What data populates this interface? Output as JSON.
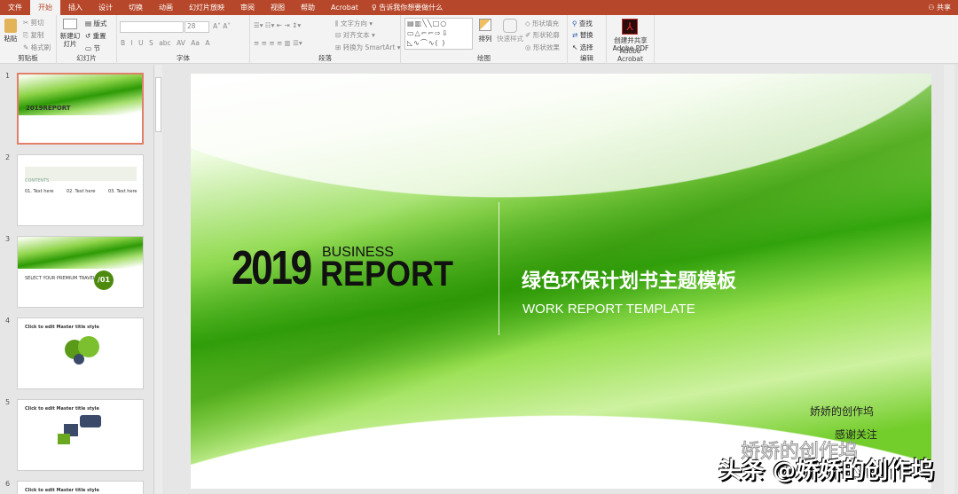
{
  "ribbon_tabs": [
    "文件",
    "开始",
    "插入",
    "设计",
    "切换",
    "动画",
    "幻灯片放映",
    "审阅",
    "视图",
    "帮助",
    "Acrobat"
  ],
  "active_tab": "开始",
  "tell_me": "告诉我你想要做什么",
  "share": "共享",
  "clipboard": {
    "paste": "粘贴",
    "cut": "剪切",
    "copy": "复制",
    "format_painter": "格式刷",
    "label": "剪贴板"
  },
  "slides_group": {
    "new_slide": "新建幻灯片",
    "layout": "版式",
    "reset": "重置",
    "section": "节",
    "label": "幻灯片"
  },
  "font_group": {
    "font_name": "",
    "font_size": "28",
    "buttons": [
      "B",
      "I",
      "U",
      "S",
      "abc",
      "AV",
      "Aa",
      "A"
    ],
    "label": "字体"
  },
  "paragraph_group": {
    "text_direction": "文字方向",
    "align_text": "对齐文本",
    "smartart": "转换为 SmartArt",
    "label": "段落"
  },
  "drawing_group": {
    "arrange": "排列",
    "quick_styles": "快速样式",
    "shape_fill": "形状填充",
    "shape_outline": "形状轮廓",
    "shape_effects": "形状效果",
    "label": "绘图"
  },
  "editing_group": {
    "find": "查找",
    "replace": "替换",
    "select": "选择",
    "label": "编辑"
  },
  "acrobat_group": {
    "create_pdf": "创建并共享 Adobe PDF",
    "label": "Adobe Acrobat"
  },
  "thumbnails": [
    {
      "num": "1",
      "title": "2019REPORT",
      "selected": true
    },
    {
      "num": "2",
      "title": "CONTENTS",
      "items": [
        "01. Text here",
        "02. Text here",
        "03. Text here"
      ]
    },
    {
      "num": "3",
      "title": "SELECT YOUR PREMIUM TRAVEL",
      "badge": "/01"
    },
    {
      "num": "4",
      "title": "Click to edit Master title style"
    },
    {
      "num": "5",
      "title": "Click to edit Master title style"
    },
    {
      "num": "6",
      "title": "Click to edit Master title style"
    }
  ],
  "slide": {
    "year": "2019",
    "business": "BUSINESS",
    "report": "REPORT",
    "cn_title": "绿色环保计划书主题模板",
    "en_subtitle": "WORK REPORT TEMPLATE",
    "author": "娇娇的创作坞",
    "thanks": "感谢关注"
  },
  "watermarks": [
    "娇娇的创作坞",
    "头条 @娇娇的创作坞"
  ],
  "colors": {
    "accent": "#b7472a",
    "green": "#3aa10a"
  }
}
